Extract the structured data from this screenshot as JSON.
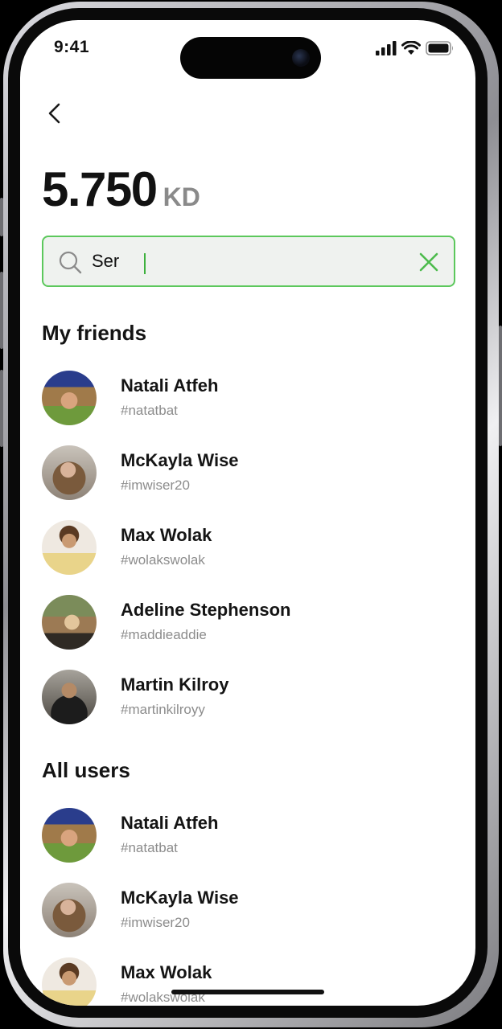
{
  "status_bar": {
    "time": "9:41"
  },
  "balance": {
    "amount": "5.750",
    "currency": "KD"
  },
  "search": {
    "value": "Ser",
    "placeholder": ""
  },
  "sections": {
    "friends_title": "My friends",
    "all_users_title": "All users"
  },
  "friends": [
    {
      "name": "Natali Atfeh",
      "handle": "#natatbat"
    },
    {
      "name": "McKayla Wise",
      "handle": "#imwiser20"
    },
    {
      "name": "Max Wolak",
      "handle": "#wolakswolak"
    },
    {
      "name": "Adeline Stephenson",
      "handle": "#maddieaddie"
    },
    {
      "name": "Martin Kilroy",
      "handle": "#martinkilroyy"
    }
  ],
  "all_users": [
    {
      "name": "Natali Atfeh",
      "handle": "#natatbat"
    },
    {
      "name": "McKayla Wise",
      "handle": "#imwiser20"
    },
    {
      "name": "Max Wolak",
      "handle": "#wolakswolak"
    }
  ],
  "icons": {
    "back": "chevron-left-icon",
    "search": "search-icon",
    "clear": "close-icon",
    "signal": "cellular-signal-icon",
    "wifi": "wifi-icon",
    "battery": "battery-icon"
  },
  "colors": {
    "accent": "#5cc85c",
    "search_bg": "#eff2ef",
    "text_primary": "#141414",
    "text_secondary": "#8c8c8c",
    "currency": "#8a8a8a"
  }
}
